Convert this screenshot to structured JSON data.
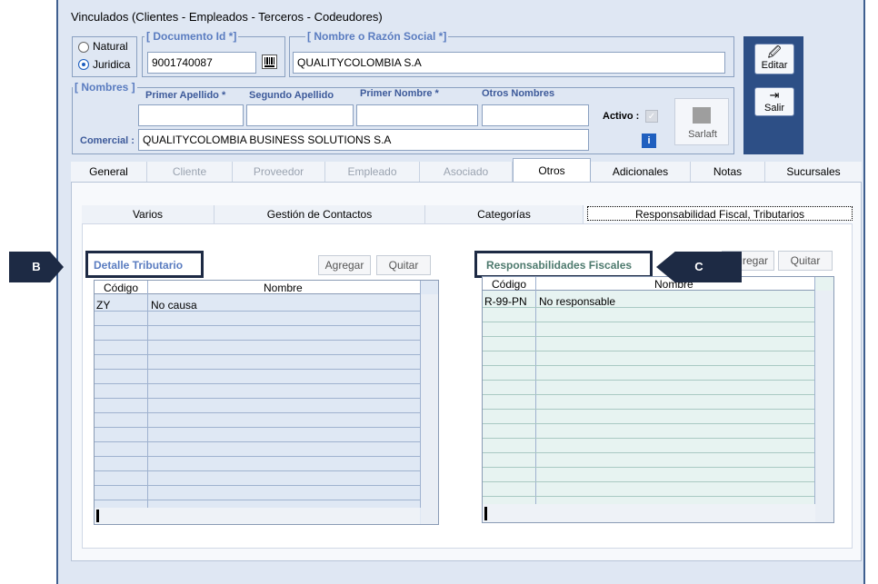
{
  "window": {
    "title": "Vinculados   (Clientes - Empleados - Terceros - Codeudores)"
  },
  "person_type": {
    "natural_label": "Natural",
    "juridica_label": "Juridica",
    "selected": "Juridica"
  },
  "documento": {
    "legend": "[ Documento Id *]",
    "value": "9001740087"
  },
  "razon_social": {
    "legend": "[ Nombre o Razón Social *]",
    "value": "QUALITYCOLOMBIA S.A"
  },
  "nombres": {
    "legend": "[ Nombres ]",
    "columns": [
      "Primer Apellido *",
      "Segundo Apellido",
      "Primer Nombre *",
      "Otros Nombres"
    ],
    "values": [
      "",
      "",
      "",
      ""
    ],
    "comercial_label": "Comercial :",
    "comercial_value": "QUALITYCOLOMBIA BUSINESS SOLUTIONS S.A",
    "activo_label": "Activo :",
    "sarlaft_label": "Sarlaft"
  },
  "toolbar": {
    "edit_label": "Editar",
    "exit_label": "Salir"
  },
  "tabs": [
    {
      "label": "General",
      "state": "normal"
    },
    {
      "label": "Cliente",
      "state": "disabled"
    },
    {
      "label": "Proveedor",
      "state": "disabled"
    },
    {
      "label": "Empleado",
      "state": "disabled"
    },
    {
      "label": "Asociado",
      "state": "disabled"
    },
    {
      "label": "Otros",
      "state": "selected"
    },
    {
      "label": "Adicionales",
      "state": "normal"
    },
    {
      "label": "Notas",
      "state": "normal"
    },
    {
      "label": "Sucursales",
      "state": "normal"
    }
  ],
  "subtabs": [
    {
      "label": "Varios"
    },
    {
      "label": "Gestión de Contactos"
    },
    {
      "label": "Categorías"
    },
    {
      "label": "Responsabilidad Fiscal, Tributarios"
    }
  ],
  "detalle": {
    "title": "Detalle Tributario",
    "add_label": "Agregar",
    "remove_label": "Quitar",
    "headers": [
      "Código",
      "Nombre"
    ],
    "rows": [
      [
        "ZY",
        "No causa"
      ]
    ]
  },
  "responsabilidades": {
    "title": "Responsabilidades Fiscales",
    "add_label": "Agregar",
    "remove_label": "Quitar",
    "headers": [
      "Código",
      "Nombre"
    ],
    "rows": [
      [
        "R-99-PN",
        "No responsable"
      ]
    ]
  },
  "callouts": {
    "b": "B",
    "c": "C"
  },
  "colors": {
    "accent": "#5a7cc0",
    "callout": "#1d2a44",
    "window_bg": "#dfe7f3"
  }
}
